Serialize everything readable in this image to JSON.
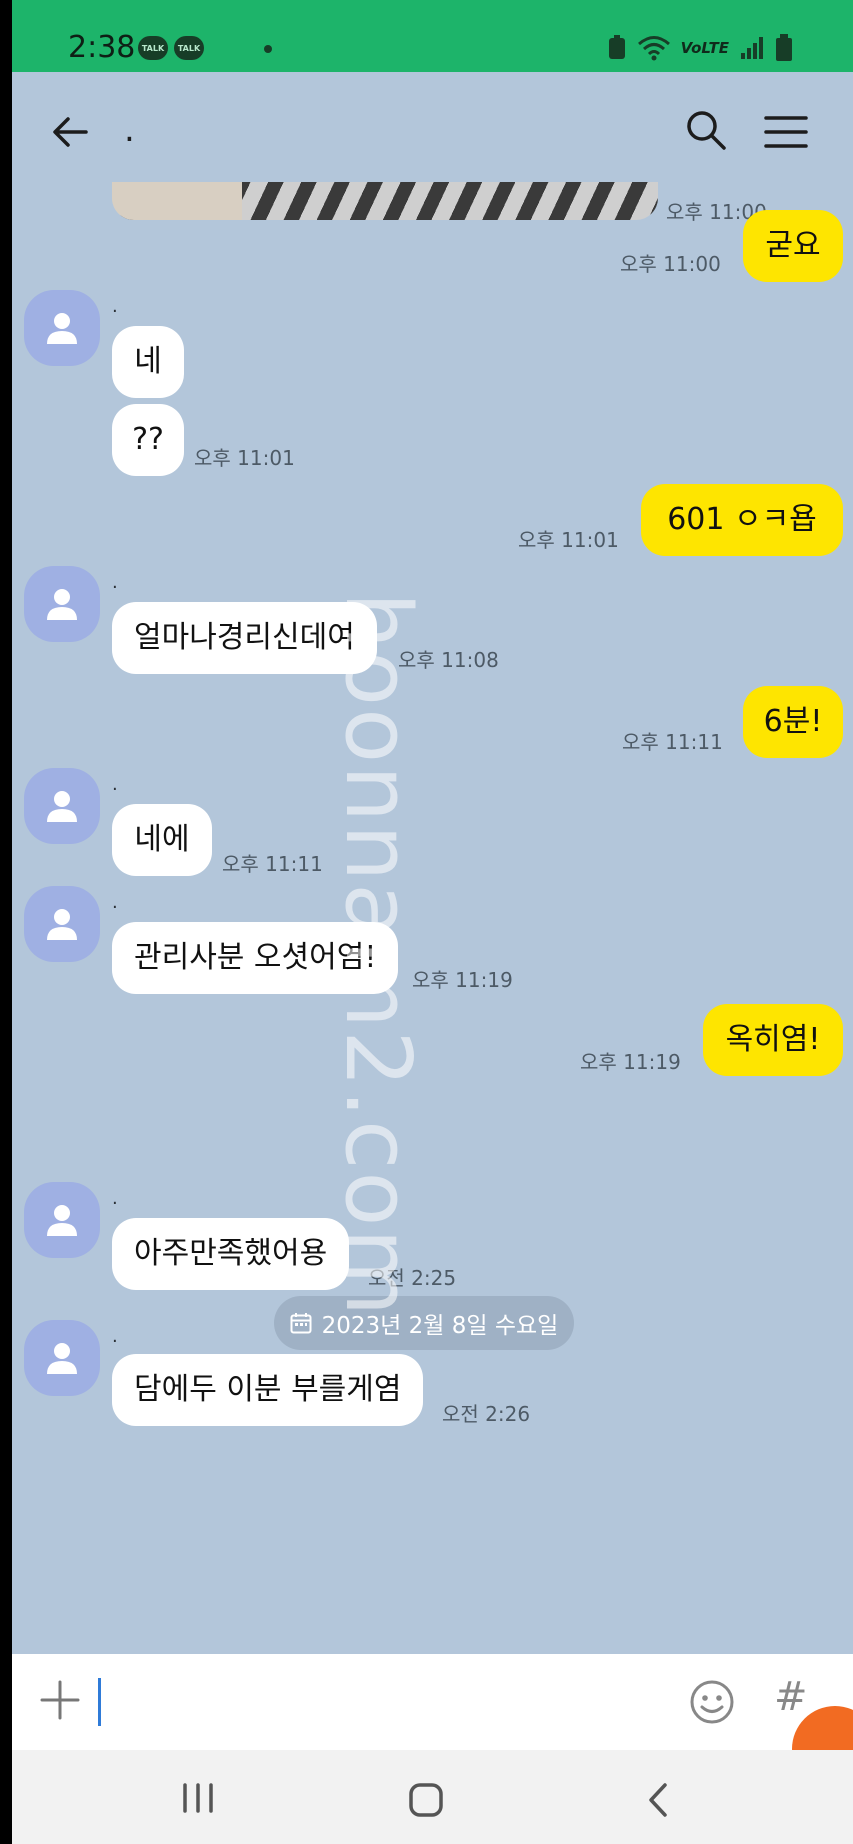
{
  "status_bar": {
    "time": "2:38",
    "talk_badge_1": "TALK",
    "talk_badge_2": "TALK",
    "network": "VoLTE"
  },
  "header": {
    "title": "."
  },
  "watermark": "hoonnam2.com",
  "top_photo_time": "오후 11:00",
  "messages": [
    {
      "dir": "out",
      "text": "굳요",
      "time": "오후 11:00"
    },
    {
      "dir": "in",
      "sender": ".",
      "text": "네"
    },
    {
      "dir": "in",
      "text": "??",
      "time": "오후 11:01"
    },
    {
      "dir": "out",
      "text": "601  ㅇㅋ욥",
      "time": "오후 11:01"
    },
    {
      "dir": "in",
      "sender": ".",
      "text": "얼마나경리신데여",
      "time": "오후 11:08"
    },
    {
      "dir": "out",
      "text": "6분!",
      "time": "오후 11:11"
    },
    {
      "dir": "in",
      "sender": ".",
      "text": "네에",
      "time": "오후 11:11"
    },
    {
      "dir": "in",
      "sender": ".",
      "text": "관리사분 오셧어염!",
      "time": "오후 11:19"
    },
    {
      "dir": "out",
      "text": "옥히염!",
      "time": "오후 11:19"
    },
    {
      "dir": "in",
      "sender": ".",
      "text": "아주만족했어용",
      "time": "오전 2:25"
    },
    {
      "dir": "in",
      "sender": ".",
      "text": "담에두 이분 부를게염",
      "time": "오전 2:26"
    }
  ],
  "date_divider": "2023년 2월 8일 수요일",
  "input": {
    "value": "",
    "hash": "#"
  },
  "colors": {
    "status_bar": "#1db46a",
    "chat_bg": "#b3c6da",
    "bubble_out": "#fee500",
    "bubble_in": "#ffffff",
    "avatar": "#9fb0e3"
  }
}
